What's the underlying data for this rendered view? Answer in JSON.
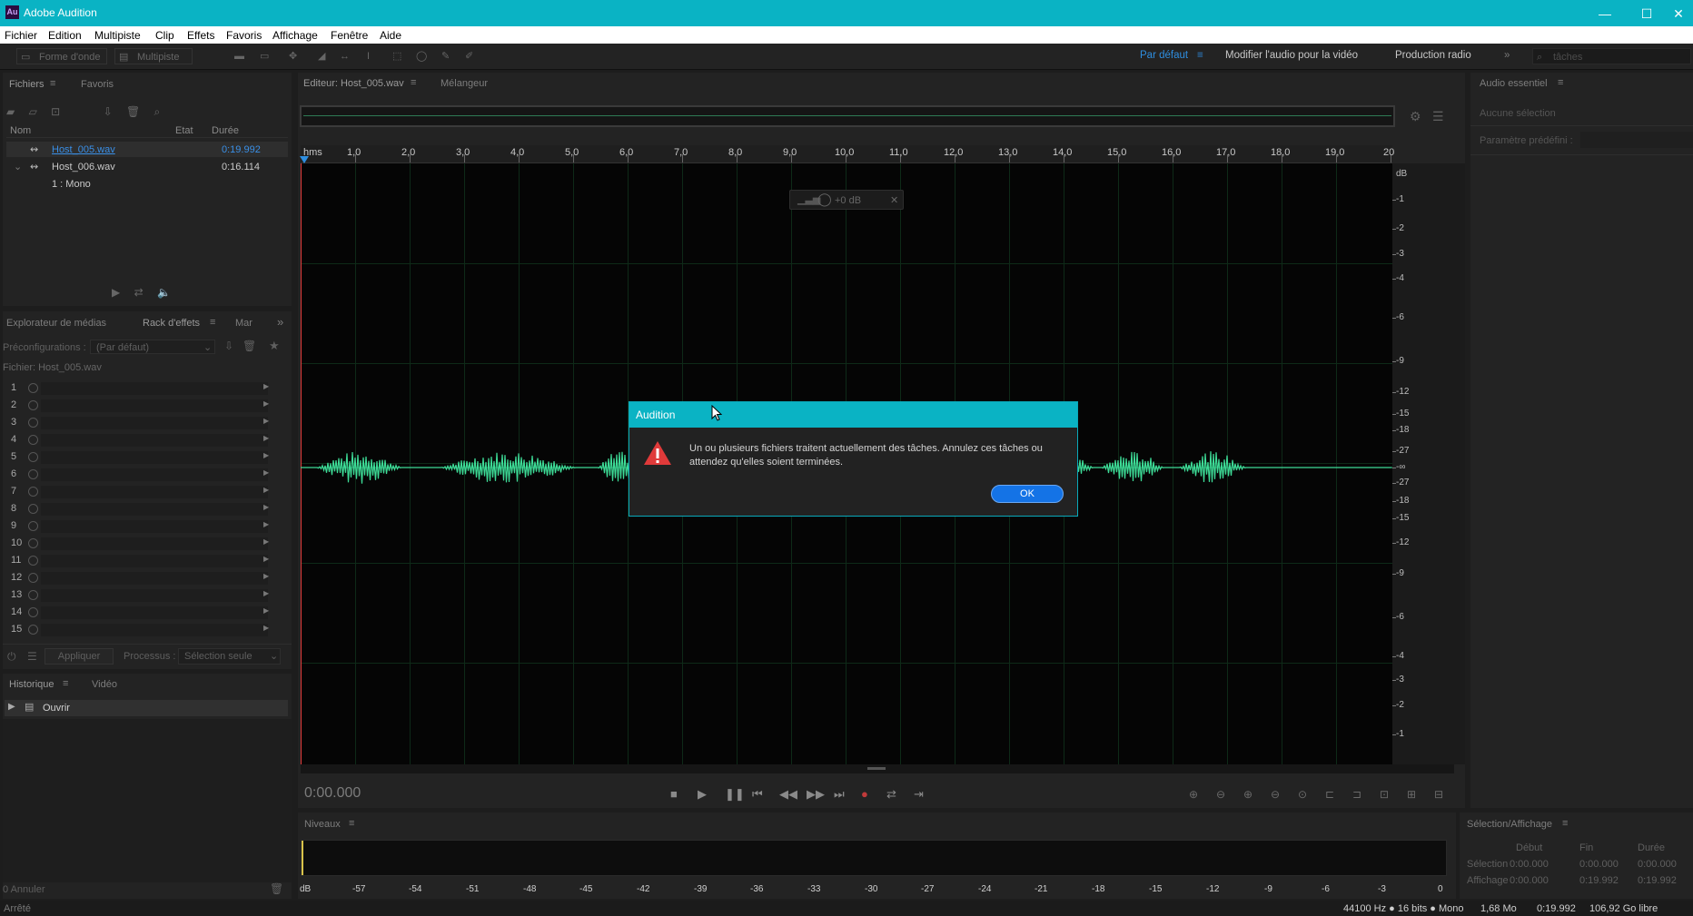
{
  "window": {
    "logo": "Au",
    "title": "Adobe Audition",
    "min": "—",
    "max": "☐",
    "close": "✕"
  },
  "menu": [
    "Fichier",
    "Edition",
    "Multipiste",
    "Clip",
    "Effets",
    "Favoris",
    "Affichage",
    "Fenêtre",
    "Aide"
  ],
  "toolbar": {
    "waveform_label": "Forme d'onde",
    "multitrack_label": "Multipiste",
    "workspaces": [
      "Par défaut",
      "Modifier l'audio pour la vidéo",
      "Production radio"
    ],
    "workspace_active_color": "#2e8ee0",
    "search_placeholder": "tâches"
  },
  "files_panel": {
    "tabs": [
      "Fichiers",
      "Favoris"
    ],
    "columns": [
      "Nom",
      "Etat",
      "Durée"
    ],
    "files": [
      {
        "name": "Host_005.wav",
        "duration": "0:19.992",
        "selected": true
      },
      {
        "name": "Host_006.wav",
        "duration": "0:16.114",
        "selected": false
      }
    ],
    "channel": "1 : Mono"
  },
  "effects_panel": {
    "tabs": [
      "Explorateur de médias",
      "Rack d'effets",
      "Mar"
    ],
    "presets_label": "Préconfigurations :",
    "presets_value": "(Par défaut)",
    "file_label": "Fichier: Host_005.wav",
    "slots": [
      "1",
      "2",
      "3",
      "4",
      "5",
      "6",
      "7",
      "8",
      "9",
      "10",
      "11",
      "12",
      "13",
      "14",
      "15"
    ],
    "apply": "Appliquer",
    "process_label": "Processus :",
    "process_value": "Sélection seule"
  },
  "history_panel": {
    "tabs": [
      "Historique",
      "Vidéo"
    ],
    "item": "Ouvrir",
    "undo": "0 Annuler"
  },
  "editor": {
    "tabs": [
      "Editeur: Host_005.wav",
      "Mélangeur"
    ],
    "ruler_unit": "hms",
    "ruler": [
      "1,0",
      "2,0",
      "3,0",
      "4,0",
      "5,0",
      "6,0",
      "7,0",
      "8,0",
      "9,0",
      "10,0",
      "11,0",
      "12,0",
      "13,0",
      "14,0",
      "15,0",
      "16,0",
      "17,0",
      "18,0",
      "19,0",
      "20"
    ],
    "db_unit": "dB",
    "db_scale": [
      "-1",
      "-2",
      "-3",
      "-4",
      "-6",
      "-9",
      "-12",
      "-15",
      "-18",
      "-27",
      "-∞",
      "-27",
      "-18",
      "-15",
      "-12",
      "-9",
      "-6",
      "-4",
      "-3",
      "-2",
      "-1"
    ],
    "hud_gain": "+0 dB",
    "timecode": "0:00.000",
    "waveform_color": "#3ddc97"
  },
  "essential_audio": {
    "title": "Audio essentiel",
    "no_selection": "Aucune sélection",
    "preset_label": "Paramètre prédéfini :"
  },
  "levels": {
    "title": "Niveaux",
    "scale": [
      "dB",
      "-57",
      "-54",
      "-51",
      "-48",
      "-45",
      "-42",
      "-39",
      "-36",
      "-33",
      "-30",
      "-27",
      "-24",
      "-21",
      "-18",
      "-15",
      "-12",
      "-9",
      "-6",
      "-3",
      "0"
    ]
  },
  "selection_panel": {
    "title": "Sélection/Affichage",
    "columns": [
      "Début",
      "Fin",
      "Durée"
    ],
    "rows": [
      {
        "label": "Sélection",
        "start": "0:00.000",
        "end": "0:00.000",
        "duration": "0:00.000"
      },
      {
        "label": "Affichage",
        "start": "0:00.000",
        "end": "0:19.992",
        "duration": "0:19.992"
      }
    ]
  },
  "status_bar": {
    "state": "Arrêté",
    "format": "44100 Hz ● 16 bits ● Mono",
    "size": "1,68 Mo",
    "duration": "0:19.992",
    "free": "106,92 Go libre"
  },
  "dialog": {
    "title": "Audition",
    "message": "Un ou plusieurs fichiers traitent actuellement des tâches. Annulez ces tâches ou attendez qu'elles soient terminées.",
    "ok": "OK",
    "warning_icon": "warning-triangle-icon",
    "accent": "#0ab3c4",
    "button_color": "#1473e6"
  }
}
